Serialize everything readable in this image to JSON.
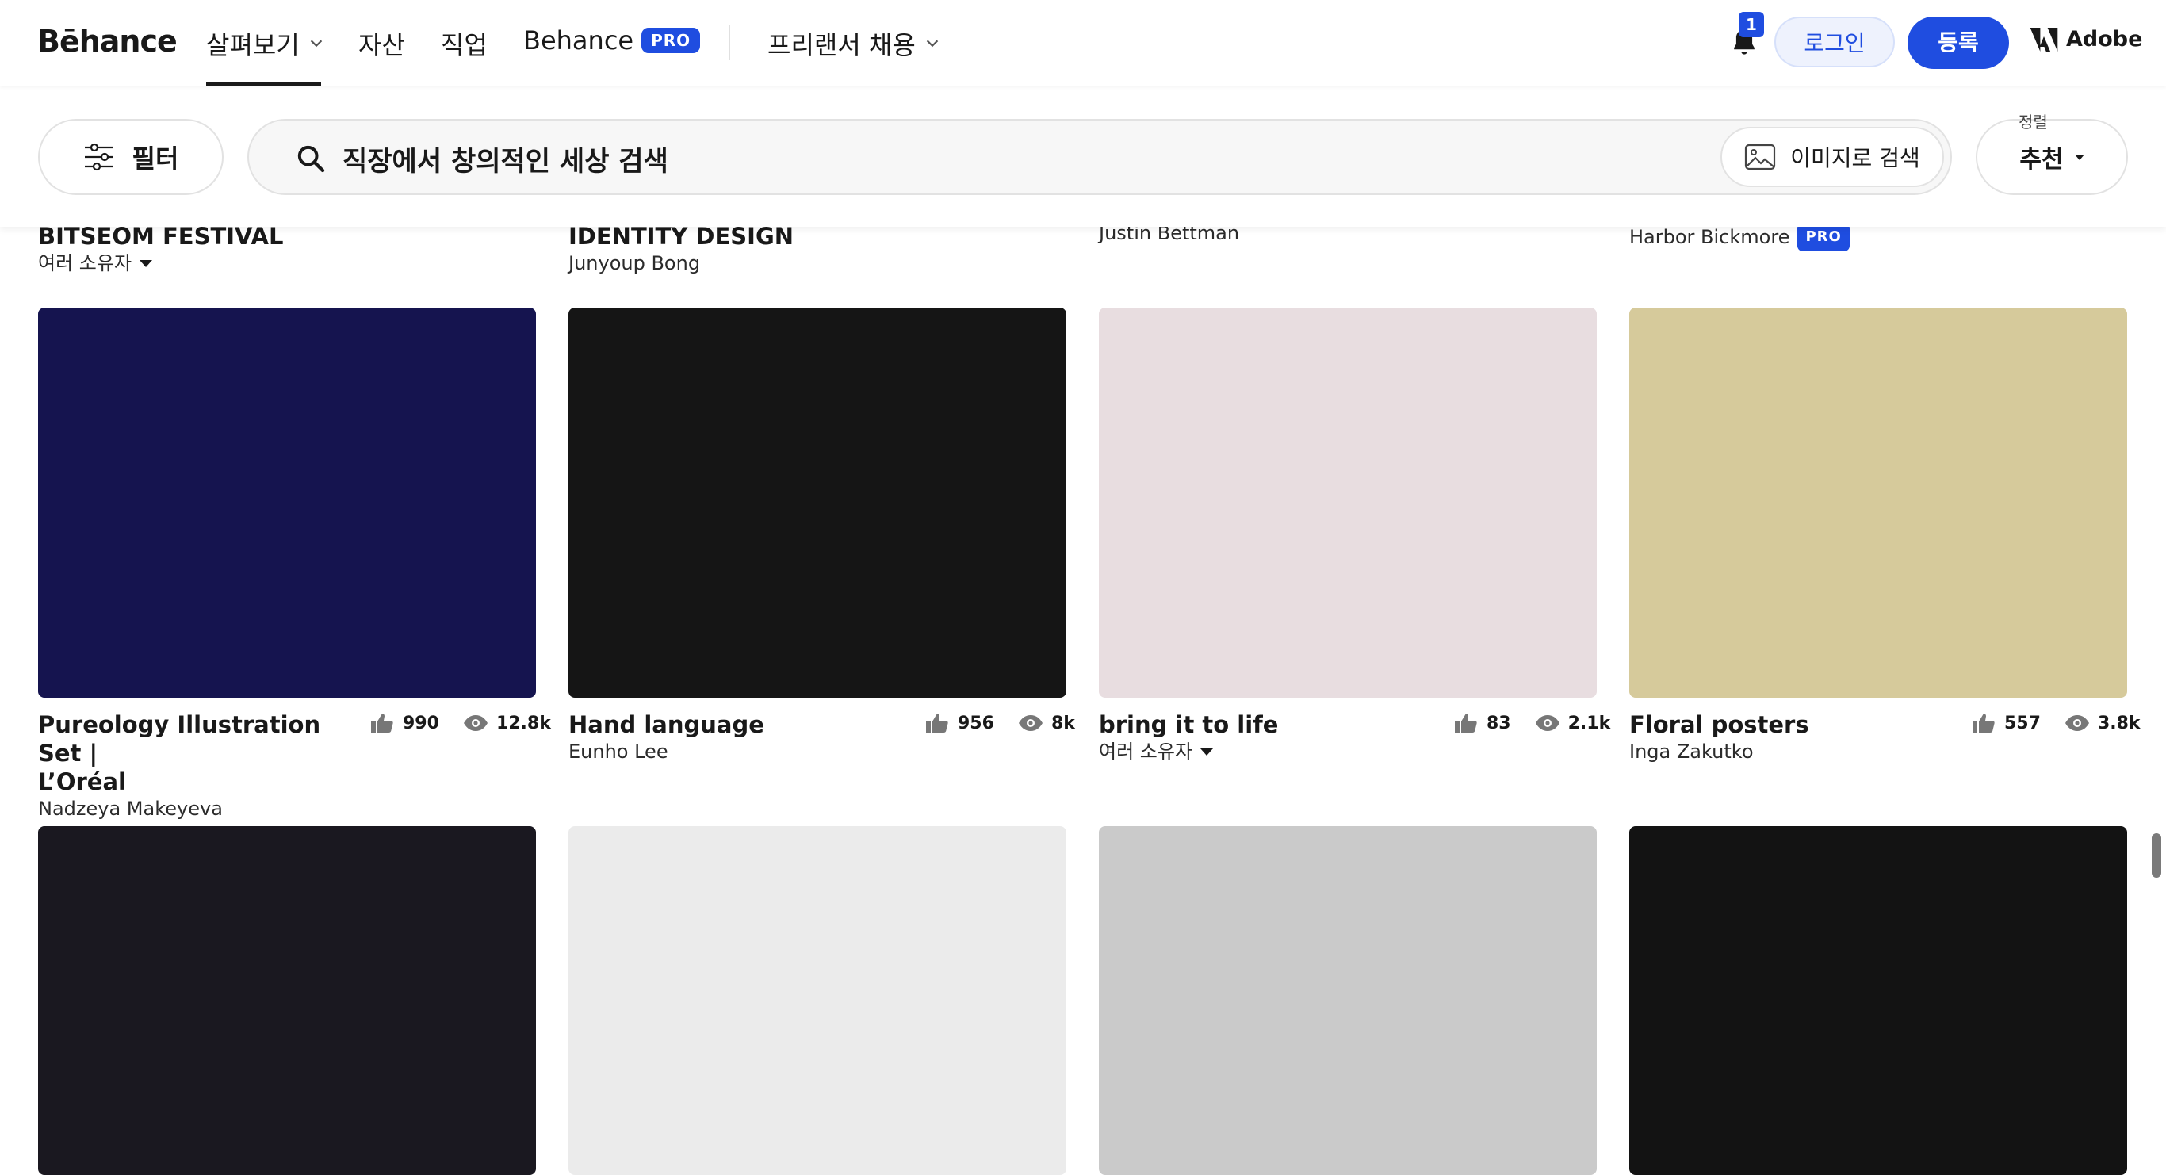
{
  "nav": {
    "logo": "Bēhance",
    "explore": "살펴보기",
    "assets": "자산",
    "jobs": "직업",
    "behance_pro": "Behance",
    "pro_badge": "PRO",
    "hire": "프리랜서 채용",
    "notification_count": "1",
    "login": "로그인",
    "signup": "등록",
    "adobe": "Adobe"
  },
  "search": {
    "filter_label": "필터",
    "placeholder": "직장에서 창의적인 세상 검색",
    "image_search_label": "이미지로 검색",
    "sort_caption": "정렬",
    "sort_value": "추천"
  },
  "row_top": [
    {
      "title": "BITSEOM FESTIVAL",
      "owner": "여러 소유자",
      "owner_dropdown": true
    },
    {
      "title": "IDENTITY DESIGN",
      "owner": "Junyoup Bong"
    },
    {
      "title": "",
      "owner": "Justin Bettman"
    },
    {
      "title": "",
      "owner": "Harbor Bickmore",
      "pro": "PRO"
    }
  ],
  "row_mid": [
    {
      "title_1": "Pureology Illustration Set |",
      "title_2": "L’Oréal",
      "owner": "Nadzeya Makeyeva",
      "likes": "990",
      "views": "12.8k",
      "color": "#15144f"
    },
    {
      "title_1": "Hand language",
      "owner": "Eunho Lee",
      "likes": "956",
      "views": "8k",
      "color": "#151515"
    },
    {
      "title_1": "bring it to life",
      "owner": "여러 소유자",
      "owner_dropdown": true,
      "likes": "83",
      "views": "2.1k",
      "color": "#e8dde0"
    },
    {
      "title_1": "Floral posters",
      "owner": "Inga Zakutko",
      "likes": "557",
      "views": "3.8k",
      "color": "#d6ca9b"
    }
  ],
  "row_bottom_colors": [
    "#1a1820",
    "#ebebeb",
    "#cacaca",
    "#131313"
  ],
  "colors": {
    "accent": "#1f4de0",
    "text": "#191919"
  }
}
